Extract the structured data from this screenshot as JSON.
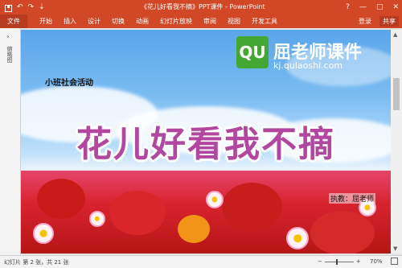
{
  "titlebar": {
    "title": "《花儿好看我不摘》PPT课件 - PowerPoint",
    "window_buttons": [
      "?",
      "—",
      "□",
      "✕"
    ]
  },
  "ribbon": {
    "file_tab": "文件",
    "tabs": [
      "开始",
      "插入",
      "设计",
      "切换",
      "动画",
      "幻灯片放映",
      "审阅",
      "视图",
      "开发工具"
    ],
    "login": "登录",
    "share": "共享"
  },
  "thumbnail_pane": {
    "label": "缩略图"
  },
  "slide": {
    "subtitle": "小班社会活动",
    "main_title": "花儿好看我不摘",
    "author": "执教：屈老师"
  },
  "watermark": {
    "logo_text": "QU",
    "name": "屈老师课件",
    "url": "kj.qulaoshi.com"
  },
  "statusbar": {
    "slide_info": "幻灯片 第 2 张，共 21 张",
    "zoom_minus": "−",
    "zoom_plus": "+",
    "zoom": "70%"
  },
  "colors": {
    "accent": "#d24726",
    "title_pink": "#b1479e",
    "logo_green": "#44a733"
  }
}
